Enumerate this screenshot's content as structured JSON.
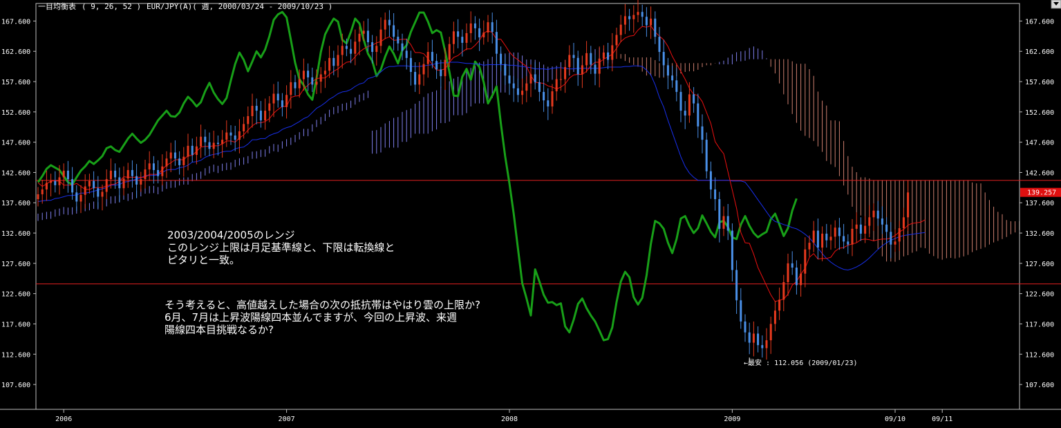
{
  "chart_data": {
    "type": "candlestick",
    "indicator_label": "一目均衡表",
    "indicator_params": "( 9, 26, 52 )",
    "symbol_range": "EUR/JPY(A)( 週, 2000/03/24 - 2009/10/23 )",
    "y_ticks": [
      "167.600",
      "162.600",
      "157.600",
      "152.600",
      "147.600",
      "142.600",
      "137.600",
      "132.600",
      "127.600",
      "122.600",
      "117.600",
      "112.600",
      "107.600"
    ],
    "ylim": [
      103.5,
      170.5
    ],
    "x_ticks": [
      {
        "label": "2006",
        "week": 6
      },
      {
        "label": "2007",
        "week": 58
      },
      {
        "label": "2008",
        "week": 110
      },
      {
        "label": "2009",
        "week": 162
      },
      {
        "label": "09/10",
        "week": 200
      },
      {
        "label": "09/11",
        "week": 211
      }
    ],
    "current_price_label": "139.257",
    "current_price": 139.257,
    "hlines": [
      {
        "value": 141.3,
        "color": "#e02020"
      },
      {
        "value": 124.2,
        "color": "#e02020"
      }
    ],
    "low_annotation": {
      "text": "←最安 : 112.056 (2009/01/23)",
      "value": 112.056,
      "week": 166
    },
    "notes": [
      {
        "lines": [
          "2003/2004/2005のレンジ",
          "このレンジ上限は月足基準線と、下限は転換線と",
          "ピタリと一致。"
        ]
      },
      {
        "lines": [
          "そう考えると、高値越えした場合の次の抵抗帯はやはり雲の上限か?",
          "6月、7月は上昇波陽線四本並んでますが、今回の上昇波、来週",
          "陽線四本目挑戦なるか?"
        ]
      }
    ],
    "series_styles": {
      "up_color": "#e83a1e",
      "down_color": "#4a90e8",
      "tenkan_color": "#ee1010",
      "kijun_color": "#1830ee",
      "chikou_color": "#18a018",
      "cloud_bear_color": "#d08070",
      "cloud_bull_color": "#8080ee"
    },
    "close": [
      139.0,
      139.8,
      140.9,
      141.2,
      140.5,
      141.8,
      142.9,
      141.5,
      139.3,
      137.8,
      138.9,
      140.3,
      141.2,
      140.0,
      138.6,
      139.4,
      141.5,
      142.9,
      141.8,
      140.0,
      141.6,
      143.0,
      142.0,
      140.6,
      141.5,
      143.1,
      144.1,
      143.0,
      142.0,
      143.6,
      144.9,
      145.9,
      144.9,
      143.8,
      145.2,
      147.0,
      145.5,
      146.9,
      148.5,
      147.6,
      146.5,
      147.5,
      147.3,
      148.0,
      149.2,
      148.7,
      148.0,
      149.4,
      150.6,
      151.9,
      153.6,
      152.8,
      151.2,
      152.8,
      154.0,
      155.6,
      154.5,
      153.4,
      155.4,
      157.5,
      156.5,
      158.0,
      159.4,
      158.3,
      157.1,
      157.6,
      158.8,
      159.4,
      161.5,
      160.2,
      162.0,
      163.5,
      163.0,
      162.2,
      164.2,
      165.5,
      166.0,
      164.1,
      162.5,
      163.5,
      166.2,
      167.8,
      166.9,
      165.0,
      163.9,
      162.7,
      161.5,
      159.2,
      157.1,
      158.8,
      160.5,
      162.5,
      161.0,
      159.6,
      158.5,
      161.2,
      163.8,
      165.9,
      165.0,
      164.0,
      165.6,
      167.2,
      166.4,
      164.9,
      165.7,
      167.4,
      165.8,
      162.2,
      160.5,
      158.6,
      157.3,
      156.5,
      155.4,
      156.1,
      157.3,
      158.8,
      157.5,
      155.9,
      154.5,
      153.5,
      156.0,
      158.0,
      158.0,
      160.0,
      162.0,
      161.5,
      158.8,
      160.3,
      162.3,
      160.4,
      158.9,
      161.4,
      162.4,
      161.2,
      163.6,
      165.3,
      167.0,
      168.4,
      167.9,
      168.6,
      169.1,
      168.3,
      166.9,
      168.0,
      165.0,
      162.5,
      160.3,
      158.6,
      157.8,
      155.9,
      152.8,
      152.0,
      155.5,
      154.0,
      150.2,
      148.0,
      142.8,
      139.8,
      138.2,
      133.3,
      135.4,
      133.0,
      126.5,
      121.5,
      118.0,
      116.2,
      114.5,
      116.0,
      114.1,
      113.6,
      114.9,
      117.6,
      119.8,
      121.6,
      124.5,
      127.6,
      126.9,
      124.0,
      125.9,
      129.9,
      131.0,
      133.0,
      130.2,
      132.5,
      131.4,
      132.0,
      133.5,
      132.1,
      131.2,
      130.7,
      133.3,
      134.0,
      132.5,
      133.8,
      135.2,
      136.3,
      135.0,
      134.0,
      132.8,
      130.7,
      131.2,
      133.4,
      135.2,
      139.3
    ],
    "tenkan": [
      140.9,
      140.3,
      140.7,
      141.2,
      141.2,
      141.2,
      140.5,
      140.5,
      140.5,
      140.8,
      140.3,
      139.8,
      139.8,
      140.1,
      140.1,
      140.1,
      140.4,
      140.6,
      140.7,
      141.1,
      141.9,
      141.8,
      141.8,
      141.8,
      141.8,
      141.8,
      142.3,
      142.3,
      142.3,
      143.1,
      143.8,
      144.2,
      144.7,
      144.7,
      144.7,
      145.4,
      145.4,
      146.1,
      146.8,
      146.9,
      146.9,
      147.0,
      147.0,
      147.3,
      147.8,
      147.8,
      147.6,
      148.3,
      148.8,
      149.6,
      150.3,
      150.8,
      150.8,
      151.0,
      151.5,
      152.4,
      153.0,
      153.5,
      153.5,
      155.0,
      155.2,
      155.3,
      156.4,
      157.0,
      157.6,
      158.1,
      158.2,
      158.2,
      158.8,
      159.3,
      159.7,
      160.3,
      160.8,
      160.9,
      161.7,
      162.5,
      163.0,
      163.4,
      163.6,
      164.0,
      164.2,
      164.7,
      165.0,
      164.4,
      164.5,
      164.6,
      164.6,
      163.7,
      162.4,
      162.4,
      162.2,
      161.4,
      160.4,
      159.5,
      159.5,
      159.7,
      160.8,
      161.6,
      161.9,
      162.5,
      163.0,
      163.0,
      163.6,
      164.4,
      165.6,
      166.0,
      165.7,
      164.6,
      164.6,
      163.6,
      162.5,
      161.7,
      161.2,
      160.6,
      160.1,
      158.6,
      157.5,
      157.4,
      157.3,
      156.9,
      156.7,
      156.4,
      156.7,
      157.2,
      158.2,
      158.7,
      158.8,
      158.8,
      159.3,
      160.2,
      160.8,
      160.8,
      161.3,
      161.7,
      162.1,
      163.1,
      164.2,
      164.8,
      165.1,
      165.2,
      166.1,
      166.7,
      166.6,
      166.8,
      165.8,
      165.1,
      164.5,
      163.4,
      161.8,
      160.5,
      159.3,
      158.0,
      156.5,
      155.5,
      155.3,
      154.3,
      152.5,
      150.7,
      147.7,
      146.6,
      145.7,
      142.7,
      139.7,
      136.7,
      132.7,
      131.0,
      130.9,
      129.1,
      126.9,
      125.4,
      123.9,
      122.4,
      121.3,
      121.5,
      121.7,
      122.5,
      124.0,
      124.6,
      125.8,
      126.8,
      128.6,
      129.2,
      128.3,
      128.4,
      128.4,
      128.6,
      129.6,
      130.1,
      130.2,
      130.6,
      130.8,
      131.0,
      131.5,
      131.6,
      131.5,
      131.3,
      131.5,
      131.6,
      131.6,
      131.8,
      132.2,
      132.8,
      133.2,
      133.9,
      134.2,
      134.3,
      134.4,
      134.8
    ],
    "kijun": [
      137.8,
      137.9,
      138.0,
      138.0,
      138.3,
      138.4,
      138.6,
      138.8,
      138.8,
      138.9,
      139.2,
      139.2,
      139.3,
      139.5,
      139.7,
      139.9,
      140.1,
      140.5,
      140.5,
      140.6,
      141.0,
      141.1,
      141.3,
      141.5,
      141.7,
      142.1,
      142.1,
      142.1,
      142.2,
      142.6,
      143.0,
      143.1,
      143.1,
      143.4,
      143.5,
      143.8,
      144.3,
      144.4,
      144.6,
      145.1,
      145.4,
      145.6,
      145.7,
      146.0,
      146.1,
      146.1,
      146.5,
      146.7,
      146.8,
      147.3,
      148.0,
      148.0,
      148.2,
      148.2,
      148.7,
      149.0,
      149.2,
      149.7,
      150.0,
      150.2,
      150.6,
      151.0,
      151.5,
      151.8,
      152.5,
      153.2,
      153.6,
      154.1,
      154.7,
      155.1,
      155.6,
      155.9,
      156.0,
      156.3,
      156.8,
      157.2,
      157.4,
      158.1,
      158.3,
      158.6,
      159.2,
      159.8,
      160.1,
      160.1,
      160.2,
      160.2,
      160.2,
      160.1,
      160.1,
      160.1,
      160.2,
      160.3,
      160.4,
      160.6,
      160.7,
      160.7,
      160.8,
      160.8,
      160.8,
      160.7,
      160.6,
      160.6,
      160.5,
      160.5,
      160.3,
      160.4,
      160.4,
      160.4,
      160.4,
      160.4,
      160.3,
      160.3,
      160.2,
      160.1,
      160.0,
      159.9,
      159.7,
      159.7,
      159.7,
      159.6,
      159.8,
      159.9,
      159.9,
      159.8,
      159.7,
      159.7,
      159.8,
      159.8,
      159.8,
      159.8,
      159.8,
      159.8,
      159.9,
      160.0,
      160.0,
      160.0,
      160.0,
      160.1,
      160.1,
      160.2,
      160.2,
      160.1,
      159.5,
      158.7,
      157.1,
      155.0,
      153.4,
      151.2,
      149.2,
      147.2,
      145.2,
      143.6,
      142.5,
      141.8,
      141.3,
      141.3,
      141.3,
      141.3,
      141.3,
      141.3,
      141.3,
      141.3,
      141.2,
      141.2,
      141.2,
      141.0,
      140.1,
      139.1,
      138.1,
      137.1,
      136.1,
      135.1,
      134.5,
      134.3,
      134.0,
      133.8,
      133.5,
      133.3,
      132.9,
      132.4,
      131.8,
      131.0,
      130.1,
      129.2,
      128.4,
      127.8,
      127.3,
      126.9,
      126.6,
      126.5,
      126.7,
      127.0,
      127.4,
      127.9,
      128.5,
      129.2,
      129.9,
      130.5,
      131.0,
      131.4,
      131.7,
      132.0,
      132.2,
      132.3,
      132.4,
      132.5,
      132.6,
      132.7
    ],
    "chikou": [
      141.0,
      142.0,
      143.2,
      143.8,
      143.4,
      143.0,
      142.0,
      141.0,
      140.6,
      141.8,
      142.9,
      143.6,
      144.5,
      144.0,
      144.6,
      145.3,
      146.6,
      146.9,
      146.3,
      146.0,
      147.1,
      148.2,
      149.0,
      148.2,
      147.5,
      148.0,
      148.8,
      150.0,
      151.2,
      152.0,
      152.8,
      151.9,
      151.8,
      152.5,
      154.0,
      155.1,
      154.4,
      153.5,
      154.2,
      156.0,
      157.4,
      155.8,
      154.7,
      153.9,
      154.9,
      157.8,
      160.5,
      162.4,
      161.2,
      159.3,
      160.9,
      162.6,
      161.6,
      162.9,
      165.1,
      167.8,
      168.7,
      169.1,
      168.2,
      164.5,
      160.7,
      158.0,
      157.0,
      155.5,
      154.6,
      158.2,
      162.5,
      165.4,
      166.8,
      168.0,
      167.5,
      164.5,
      163.9,
      165.8,
      168.0,
      167.2,
      164.5,
      162.2,
      161.0,
      158.5,
      159.6,
      161.7,
      163.4,
      162.2,
      160.6,
      162.8,
      163.6,
      165.8,
      167.4,
      169.0,
      169.0,
      167.5,
      165.6,
      166.1,
      165.7,
      162.6,
      159.2,
      155.3,
      155.2,
      158.4,
      159.7,
      157.9,
      160.9,
      160.0,
      157.5,
      154.0,
      155.3,
      156.8,
      150.7,
      145.3,
      140.8,
      135.8,
      130.0,
      124.3,
      121.8,
      119.0,
      126.6,
      124.6,
      122.4,
      121.1,
      121.2,
      120.7,
      121.0,
      117.2,
      116.2,
      118.3,
      120.9,
      121.8,
      120.2,
      119.0,
      118.0,
      116.5,
      114.9,
      115.1,
      117.0,
      121.2,
      124.6,
      126.2,
      125.3,
      122.0,
      120.8,
      121.9,
      125.6,
      130.8,
      134.6,
      134.2,
      133.3,
      131.0,
      129.3,
      131.6,
      135.0,
      135.4,
      133.8,
      132.6,
      133.4,
      135.5,
      134.2,
      132.8,
      131.9,
      134.4,
      134.6,
      133.6,
      131.9,
      131.6,
      134.0,
      135.4,
      133.8,
      132.6,
      131.9,
      132.4,
      132.8,
      134.9,
      135.8,
      134.0,
      132.1,
      133.4,
      136.3,
      138.3
    ]
  }
}
